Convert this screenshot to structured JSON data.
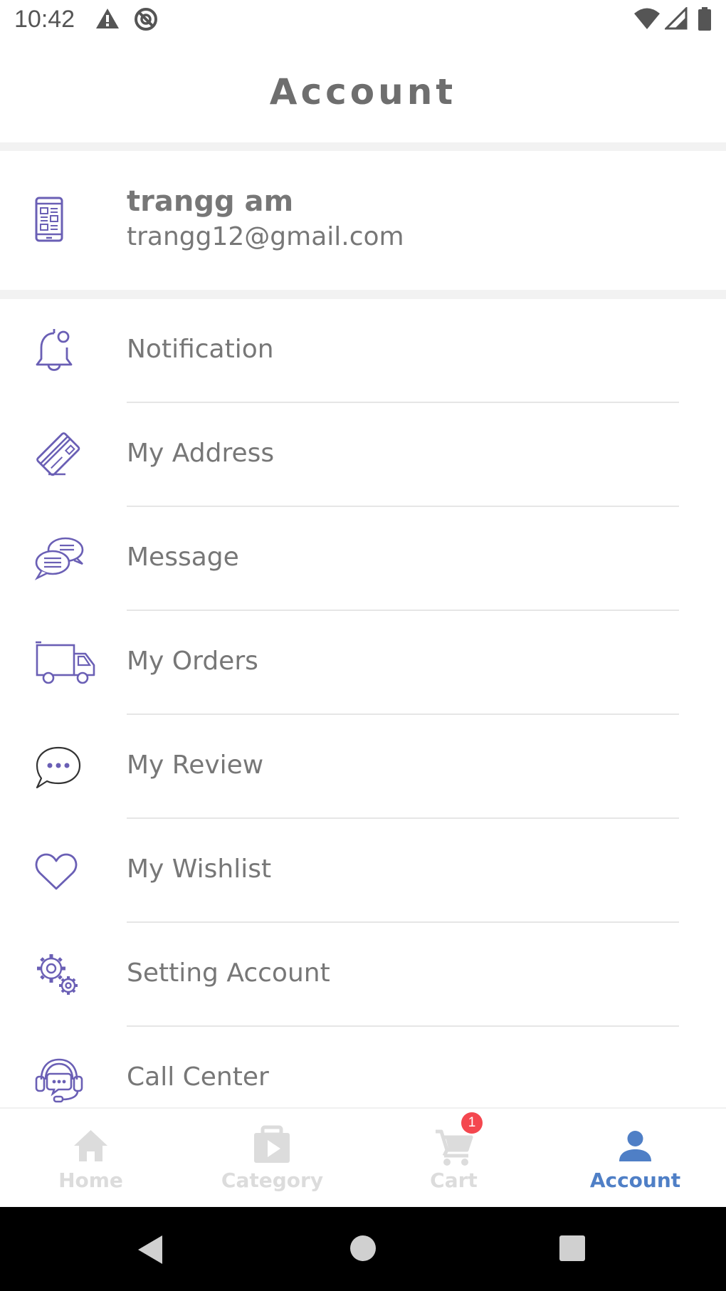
{
  "status_bar": {
    "time": "10:42",
    "icons": [
      "alert-icon",
      "no-sync-icon",
      "wifi-icon",
      "signal-icon",
      "battery-icon"
    ]
  },
  "header": {
    "title": "Account"
  },
  "profile": {
    "name": "trangg am",
    "email": "trangg12@gmail.com",
    "icon": "phone-layout-icon"
  },
  "menu": {
    "items": [
      {
        "label": "Notification",
        "icon": "bell-icon"
      },
      {
        "label": "My Address",
        "icon": "card-icon"
      },
      {
        "label": "Message",
        "icon": "chat-bubbles-icon"
      },
      {
        "label": "My Orders",
        "icon": "truck-icon"
      },
      {
        "label": "My Review",
        "icon": "speech-bubble-icon"
      },
      {
        "label": "My Wishlist",
        "icon": "heart-icon"
      },
      {
        "label": "Setting Account",
        "icon": "gears-icon"
      },
      {
        "label": "Call Center",
        "icon": "headset-icon"
      }
    ]
  },
  "bottom_nav": {
    "tabs": [
      {
        "label": "Home",
        "icon": "home-icon",
        "active": false
      },
      {
        "label": "Category",
        "icon": "briefcase-play-icon",
        "active": false
      },
      {
        "label": "Cart",
        "icon": "cart-icon",
        "active": false,
        "badge": "1"
      },
      {
        "label": "Account",
        "icon": "person-icon",
        "active": true
      }
    ]
  },
  "colors": {
    "icon": "#6a5fb5",
    "text": "#777777",
    "active_tab": "#4f7fc6",
    "inactive_tab": "#dcdcdc",
    "badge": "#f4474f"
  }
}
